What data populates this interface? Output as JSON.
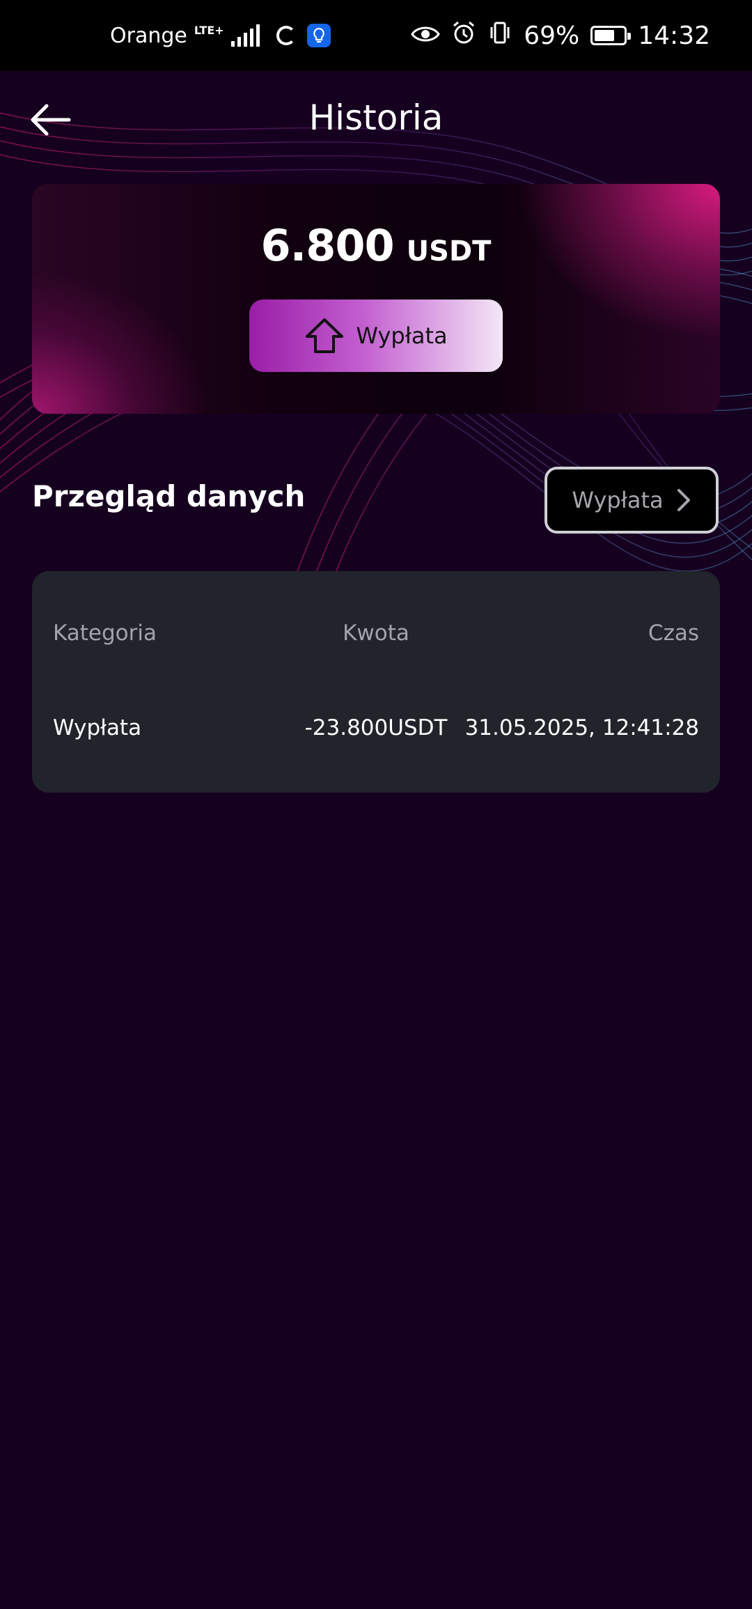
{
  "status_bar": {
    "carrier": "Orange",
    "network": "LTE+",
    "battery": "69%",
    "battery_level": 0.69,
    "time": "14:32"
  },
  "header": {
    "title": "Historia",
    "back_icon": "arrow-left-icon"
  },
  "balance": {
    "amount": "6.800",
    "currency": "USDT",
    "withdraw_label": "Wypłata",
    "withdraw_icon": "house-up-arrow-icon"
  },
  "overview": {
    "title": "Przegląd danych",
    "filter_label": "Wypłata",
    "filter_icon": "chevron-right-icon"
  },
  "table": {
    "headers": [
      "Kategoria",
      "Kwota",
      "Czas"
    ],
    "rows": [
      [
        "Wypłata",
        "-23.800USDT",
        "31.05.2025, 12:41:28"
      ]
    ]
  },
  "colors": {
    "background": "#160020",
    "card_accent": "#d81b7e",
    "button_gradient_start": "#9a1ea6",
    "table_bg": "#22242b"
  }
}
